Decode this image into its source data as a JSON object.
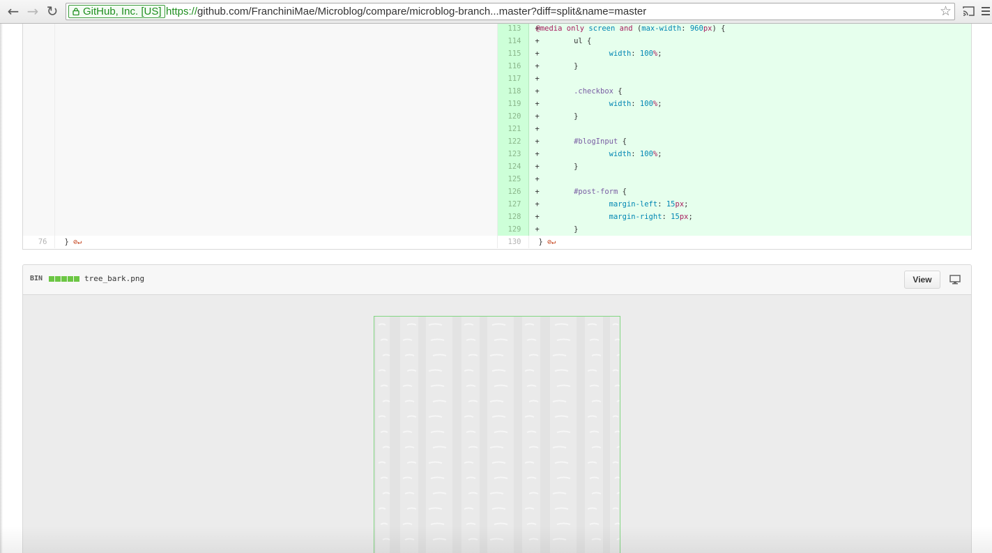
{
  "browser": {
    "ev_label": "GitHub, Inc. [US]",
    "url_scheme": "https://",
    "url_rest": "github.com/FranchiniMae/Microblog/compare/microblog-branch...master?diff=split&name=master",
    "icons": [
      "back-arrow-icon",
      "forward-arrow-icon",
      "reload-icon",
      "lock-icon",
      "star-icon",
      "cast-icon",
      "menu-icon"
    ]
  },
  "diff": {
    "added_lines": [
      {
        "num": "113",
        "code": "@media only screen and (max-width: 960px) {"
      },
      {
        "num": "114",
        "code": "\tul {"
      },
      {
        "num": "115",
        "code": "\t\twidth: 100%;"
      },
      {
        "num": "116",
        "code": "\t}"
      },
      {
        "num": "117",
        "code": ""
      },
      {
        "num": "118",
        "code": "\t.checkbox {"
      },
      {
        "num": "119",
        "code": "\t\twidth: 100%;"
      },
      {
        "num": "120",
        "code": "\t}"
      },
      {
        "num": "121",
        "code": ""
      },
      {
        "num": "122",
        "code": "\t#blogInput {"
      },
      {
        "num": "123",
        "code": "\t\twidth: 100%;"
      },
      {
        "num": "124",
        "code": "\t}"
      },
      {
        "num": "125",
        "code": ""
      },
      {
        "num": "126",
        "code": "\t#post-form {"
      },
      {
        "num": "127",
        "code": "\t\tmargin-left: 15px;"
      },
      {
        "num": "128",
        "code": "\t\tmargin-right: 15px;"
      },
      {
        "num": "129",
        "code": "\t}"
      }
    ],
    "context_line": {
      "left_num": "76",
      "right_num": "130",
      "code": "}"
    },
    "added_marker": "+",
    "no_newline_icon": "no-newline-icon"
  },
  "file": {
    "type_label": "BIN",
    "name": "tree_bark.png",
    "view_button": "View",
    "diffstat_color": "#6cc644",
    "display_icon": "display-icon"
  },
  "colors": {
    "added_bg": "#e6ffed",
    "added_num_bg": "#cdffd8",
    "image_border": "#82d682"
  }
}
